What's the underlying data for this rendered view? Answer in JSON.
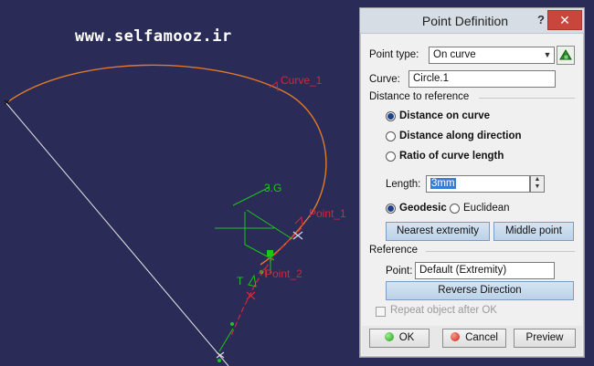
{
  "watermark": "www.selfamooz.ir",
  "viewport": {
    "labels": {
      "curve_1": "Curve_1",
      "point_1": "Point_1",
      "point_2": "Point_2",
      "axis_label": "3.G",
      "tangent_label": "T"
    },
    "colors": {
      "background": "#2b2b58",
      "curve": "#e07a2a",
      "label": "#d8243a",
      "green": "#19c619",
      "white_line": "#e6e6e6"
    }
  },
  "dialog": {
    "title": "Point Definition",
    "help": "?",
    "close": "✕",
    "point_type": {
      "label": "Point type:",
      "value": "On curve",
      "icon": "construction-icon"
    },
    "curve": {
      "label": "Curve:",
      "value": "Circle.1"
    },
    "distance_section": "Distance to reference",
    "distance_options": [
      {
        "label": "Distance on curve",
        "checked": true
      },
      {
        "label": "Distance along direction",
        "checked": false
      },
      {
        "label": "Ratio of curve length",
        "checked": false
      }
    ],
    "length": {
      "label": "Length:",
      "value": "3mm"
    },
    "geodesic": {
      "label": "Geodesic",
      "checked": true
    },
    "euclidean": {
      "label": "Euclidean",
      "checked": false
    },
    "nearest_extremity": "Nearest extremity",
    "middle_point": "Middle point",
    "reference_section": "Reference",
    "reference_point": {
      "label": "Point:",
      "value": "Default (Extremity)"
    },
    "reverse_direction": "Reverse Direction",
    "repeat_object": "Repeat object after OK",
    "ok": "OK",
    "cancel": "Cancel",
    "preview": "Preview"
  }
}
